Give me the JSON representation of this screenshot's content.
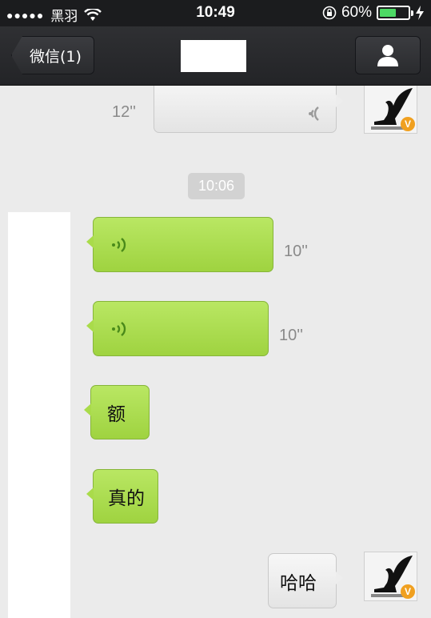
{
  "status_bar": {
    "signal_dots": "●●●●●",
    "carrier": "黑羽",
    "time": "10:49",
    "battery": "60%",
    "battery_level": 0.6
  },
  "nav": {
    "back_label": "微信(1)"
  },
  "messages": {
    "first_voice_duration": "12''",
    "timestamp": "10:06",
    "voice1_duration": "10''",
    "voice2_duration": "10''",
    "text1": "额",
    "text2": "真的",
    "my_text": "哈哈"
  },
  "avatar_badge": "V",
  "colors": {
    "green_bubble": "#a9db4a",
    "white_bubble": "#ededed",
    "navbar": "#2a2b2e",
    "battery": "#4cd964"
  }
}
